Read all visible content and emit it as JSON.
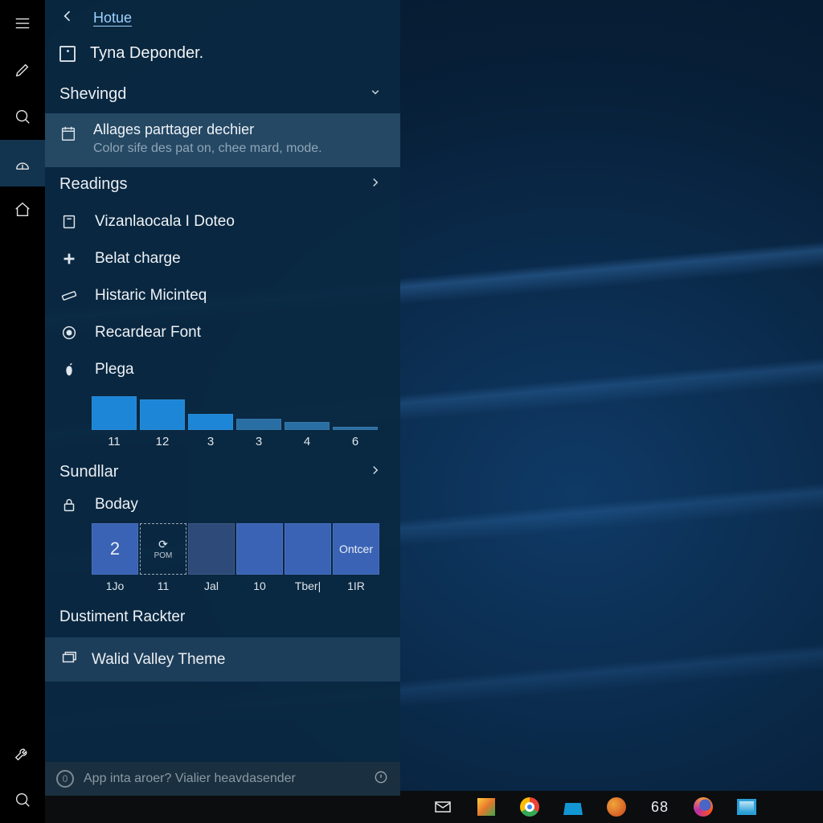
{
  "header": {
    "crumb": "Hotue",
    "account_name": "Tyna Deponder."
  },
  "sections": {
    "shevingd": {
      "title": "Shevingd",
      "item_title": "Allages parttager dechier",
      "item_sub": "Color sife des pat on, chee mard, mode."
    },
    "readings": {
      "title": "Readings",
      "items": [
        "Vizanlaocala I Doteo",
        "Belat charge",
        "Histaric Micinteq",
        "Recardear Font",
        "Plega"
      ]
    },
    "sundllar": {
      "title": "Sundllar",
      "boday": "Boday"
    },
    "dustiment": {
      "title": "Dustiment Rackter"
    },
    "theme": {
      "title": "Walid Valley Theme"
    }
  },
  "search": {
    "placeholder": "App inta aroer? Vialier heavdasender"
  },
  "taskbar": {
    "clock": "68"
  },
  "tiles": {
    "values": [
      "2",
      "⟳",
      "",
      "",
      "",
      "Ontcer"
    ],
    "sub": [
      "",
      "POM",
      "",
      "",
      "",
      ""
    ],
    "labels": [
      "1Jo",
      "11",
      "Jal",
      "10",
      "Tber|",
      "1IR"
    ]
  },
  "chart_data": {
    "type": "bar",
    "categories": [
      "11",
      "12",
      "3",
      "3",
      "4",
      "6"
    ],
    "values": [
      42,
      38,
      20,
      14,
      10,
      4
    ],
    "title": "",
    "xlabel": "",
    "ylabel": "",
    "ylim": [
      0,
      48
    ]
  },
  "colors": {
    "accent": "#1d86d6",
    "tile": "#3a63b5",
    "panel": "#0c2a42"
  }
}
